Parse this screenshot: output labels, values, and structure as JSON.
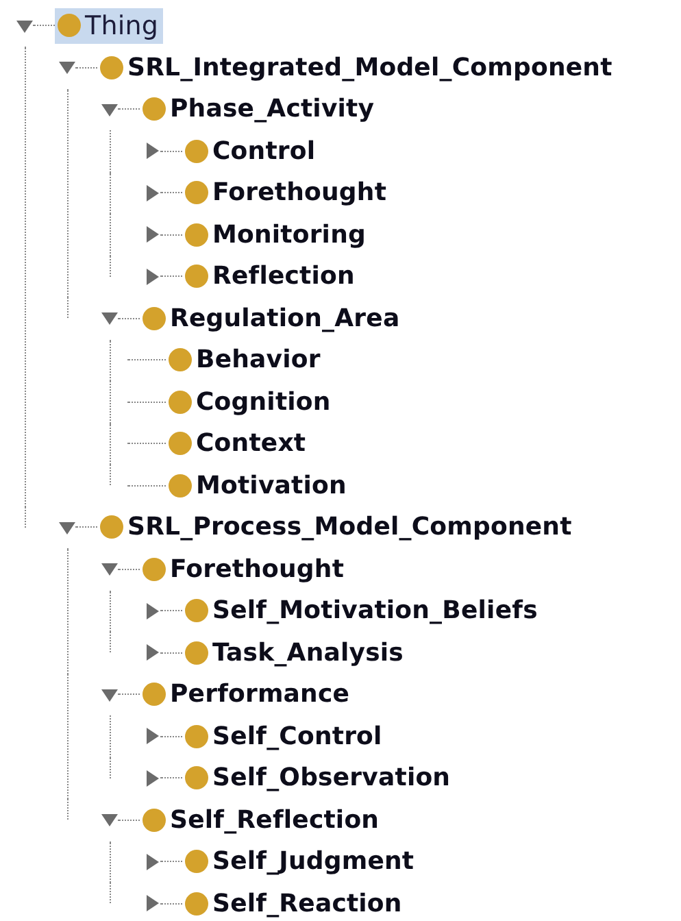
{
  "tree": [
    {
      "label": "Thing",
      "selected": true,
      "kind": "branch",
      "expanded": true,
      "children": [
        {
          "label": "SRL_Integrated_Model_Component",
          "selected": false,
          "kind": "branch",
          "expanded": true,
          "children": [
            {
              "label": "Phase_Activity",
              "selected": false,
              "kind": "branch",
              "expanded": true,
              "children": [
                {
                  "label": "Control",
                  "selected": false,
                  "kind": "branch",
                  "expanded": false
                },
                {
                  "label": "Forethought",
                  "selected": false,
                  "kind": "branch",
                  "expanded": false
                },
                {
                  "label": "Monitoring",
                  "selected": false,
                  "kind": "branch",
                  "expanded": false
                },
                {
                  "label": "Reflection",
                  "selected": false,
                  "kind": "branch",
                  "expanded": false
                }
              ]
            },
            {
              "label": "Regulation_Area",
              "selected": false,
              "kind": "branch",
              "expanded": true,
              "children": [
                {
                  "label": "Behavior",
                  "selected": false,
                  "kind": "leaf"
                },
                {
                  "label": "Cognition",
                  "selected": false,
                  "kind": "leaf"
                },
                {
                  "label": "Context",
                  "selected": false,
                  "kind": "leaf"
                },
                {
                  "label": "Motivation",
                  "selected": false,
                  "kind": "leaf"
                }
              ]
            }
          ]
        },
        {
          "label": "SRL_Process_Model_Component",
          "selected": false,
          "kind": "branch",
          "expanded": true,
          "children": [
            {
              "label": "Forethought",
              "selected": false,
              "kind": "branch",
              "expanded": true,
              "children": [
                {
                  "label": "Self_Motivation_Beliefs",
                  "selected": false,
                  "kind": "branch",
                  "expanded": false
                },
                {
                  "label": "Task_Analysis",
                  "selected": false,
                  "kind": "branch",
                  "expanded": false
                }
              ]
            },
            {
              "label": "Performance",
              "selected": false,
              "kind": "branch",
              "expanded": true,
              "children": [
                {
                  "label": "Self_Control",
                  "selected": false,
                  "kind": "branch",
                  "expanded": false
                },
                {
                  "label": "Self_Observation",
                  "selected": false,
                  "kind": "branch",
                  "expanded": false
                }
              ]
            },
            {
              "label": "Self_Reflection",
              "selected": false,
              "kind": "branch",
              "expanded": true,
              "children": [
                {
                  "label": "Self_Judgment",
                  "selected": false,
                  "kind": "branch",
                  "expanded": false
                },
                {
                  "label": "Self_Reaction",
                  "selected": false,
                  "kind": "branch",
                  "expanded": false
                }
              ]
            }
          ]
        }
      ]
    }
  ]
}
